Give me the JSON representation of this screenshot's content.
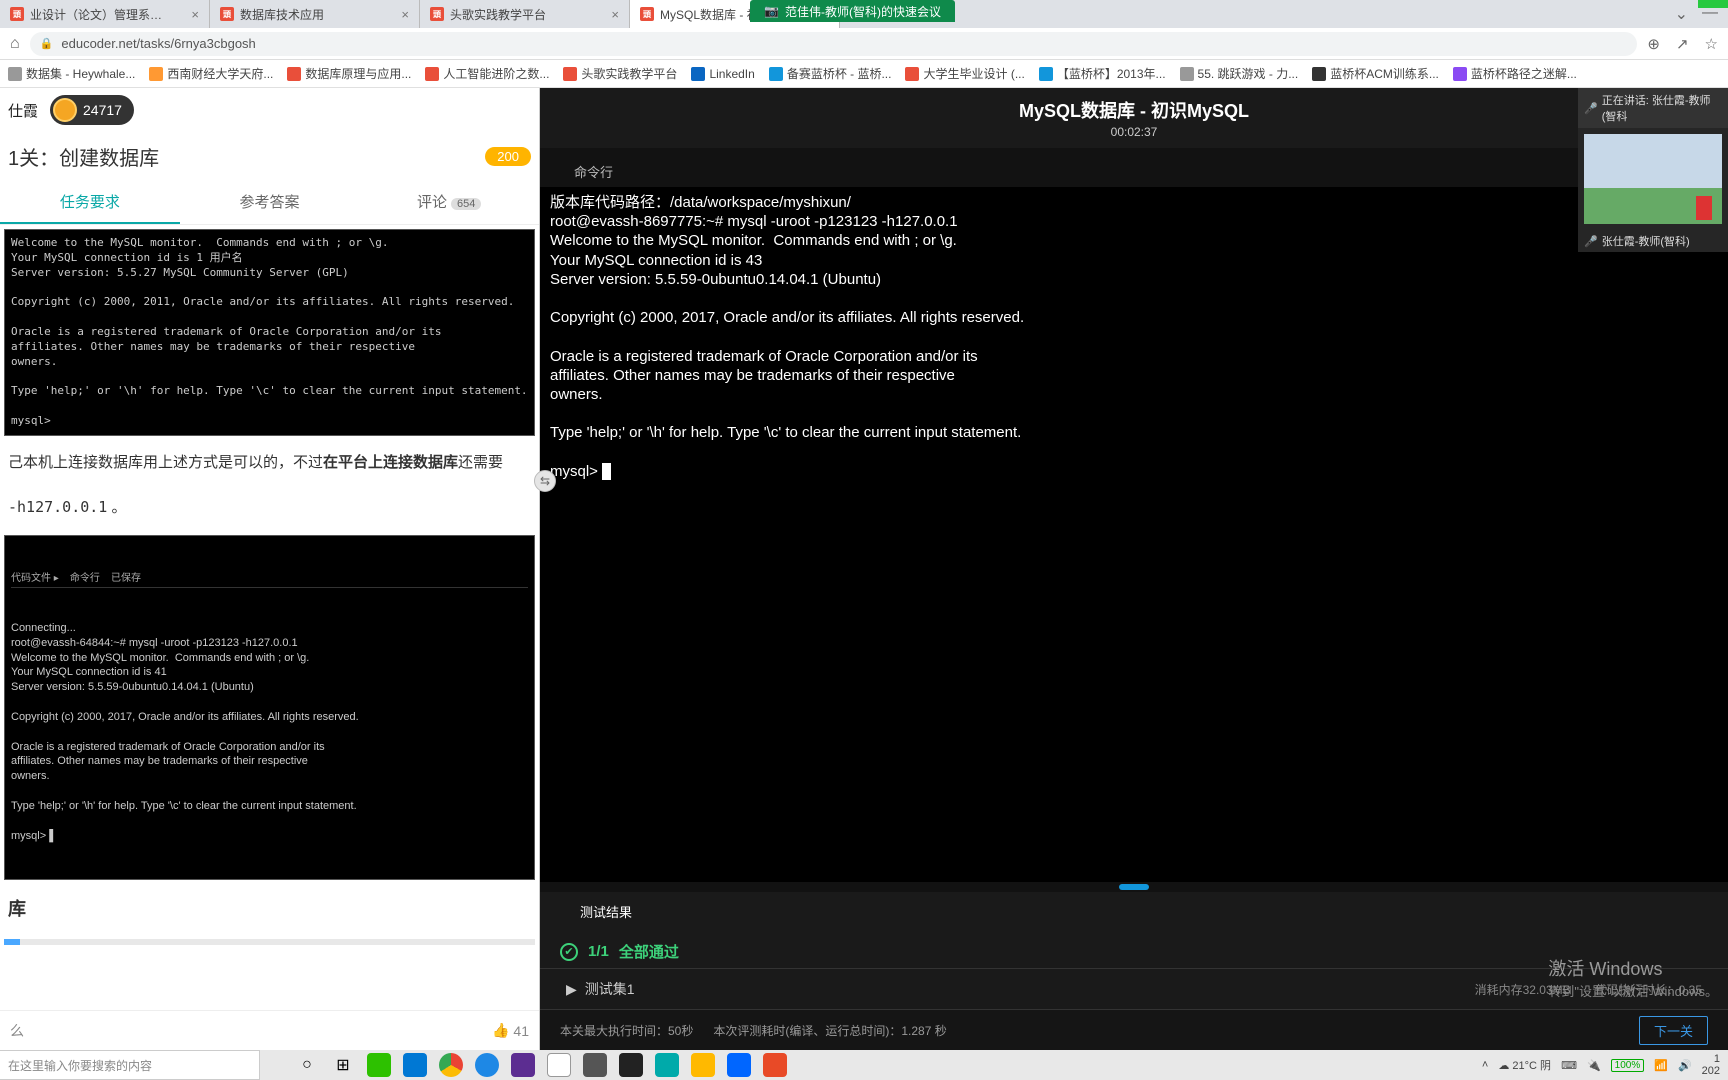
{
  "meeting_bar": "范佳伟-教师(智科)的快速会议",
  "browser": {
    "tabs": [
      {
        "fav": "red",
        "label": "业设计（论文）管理系…",
        "active": false
      },
      {
        "fav": "red",
        "label": "数据库技术应用",
        "active": false
      },
      {
        "fav": "red",
        "label": "头歌实践教学平台",
        "active": false
      },
      {
        "fav": "red",
        "label": "MySQL数据库 - 初…",
        "active": true
      }
    ],
    "url": "educoder.net/tasks/6rnya3cbgosh",
    "bookmarks": [
      {
        "cls": "grey",
        "label": "数据集 - Heywhale..."
      },
      {
        "cls": "orange",
        "label": "西南财经大学天府..."
      },
      {
        "cls": "red",
        "label": "数据库原理与应用..."
      },
      {
        "cls": "red",
        "label": "人工智能进阶之数..."
      },
      {
        "cls": "red",
        "label": "头歌实践教学平台"
      },
      {
        "cls": "blue",
        "label": "LinkedIn"
      },
      {
        "cls": "cyan",
        "label": "备赛蓝桥杯 - 蓝桥..."
      },
      {
        "cls": "red",
        "label": "大学生毕业设计 (..."
      },
      {
        "cls": "cyan",
        "label": "【蓝桥杯】2013年..."
      },
      {
        "cls": "grey",
        "label": "55. 跳跃游戏 - 力..."
      },
      {
        "cls": "dark",
        "label": "蓝桥杯ACM训练系..."
      },
      {
        "cls": "purple",
        "label": "蓝桥杯路径之迷解..."
      }
    ]
  },
  "left": {
    "username": "仕霞",
    "coins": "24717",
    "stage": "1关：创建数据库",
    "points": "200",
    "tabs": {
      "req": "任务要求",
      "ans": "参考答案",
      "com": "评论",
      "com_cnt": "654"
    },
    "term1": "Welcome to the MySQL monitor.  Commands end with ; or \\g.\nYour MySQL connection id is 1 用户名\nServer version: 5.5.27 MySQL Community Server (GPL)\n\nCopyright (c) 2000, 2011, Oracle and/or its affiliates. All rights reserved.\n\nOracle is a registered trademark of Oracle Corporation and/or its\naffiliates. Other names may be trademarks of their respective\nowners.\n\nType 'help;' or '\\h' for help. Type '\\c' to clear the current input statement.\n\nmysql>",
    "para_pre": "己本机上连接数据库用上述方式是可以的，不过",
    "para_bold": "在平台上连接数据库",
    "para_post": "还需要",
    "code_inline": "-h127.0.0.1",
    "para_tail": " 。",
    "term2_tabs": "代码文件 ▸    命令行    已保存",
    "term2": "Connecting...\nroot@evassh-64844:~# mysql -uroot -p123123 -h127.0.0.1\nWelcome to the MySQL monitor.  Commands end with ; or \\g.\nYour MySQL connection id is 41\nServer version: 5.5.59-0ubuntu0.14.04.1 (Ubuntu)\n\nCopyright (c) 2000, 2017, Oracle and/or its affiliates. All rights reserved.\n\nOracle is a registered trademark of Oracle Corporation and/or its\naffiliates. Other names may be trademarks of their respective\nowners.\n\nType 'help;' or '\\h' for help. Type '\\c' to clear the current input statement.\n\nmysql> ▌",
    "section_title": "库",
    "like": "41"
  },
  "right": {
    "title": "MySQL数据库 - 初识MySQL",
    "timer": "00:02:37",
    "tab": "命令行",
    "terminal": "版本库代码路径：/data/workspace/myshixun/\nroot@evassh-8697775:~# mysql -uroot -p123123 -h127.0.0.1\nWelcome to the MySQL monitor.  Commands end with ; or \\g.\nYour MySQL connection id is 43\nServer version: 5.5.59-0ubuntu0.14.04.1 (Ubuntu)\n\nCopyright (c) 2000, 2017, Oracle and/or its affiliates. All rights reserved.\n\nOracle is a registered trademark of Oracle Corporation and/or its\naffiliates. Other names may be trademarks of their respective\nowners.\n\nType 'help;' or '\\h' for help. Type '\\c' to clear the current input statement.\n\nmysql> ",
    "results": {
      "tab": "测试结果",
      "ratio": "1/1",
      "pass": "全部通过",
      "testset": "测试集1",
      "mem": "消耗内存32.03MB",
      "time": "代码执行时长：0.35"
    },
    "activate": {
      "l1": "激活 Windows",
      "l2": "转到\"设置\"以激活 Windows。"
    },
    "footer": {
      "exec": "本关最大执行时间：50秒",
      "eval": "本次评测耗时(编译、运行总时间)：1.287 秒",
      "next": "下一关"
    }
  },
  "video": {
    "speaking": "正在讲话: 张仕霞-教师(智科",
    "name": "张仕霞-教师(智科)"
  },
  "taskbar": {
    "search_ph": "在这里输入你要搜索的内容",
    "weather": "21°C 阴",
    "batt": "100%",
    "time": "1",
    "date": "202"
  }
}
